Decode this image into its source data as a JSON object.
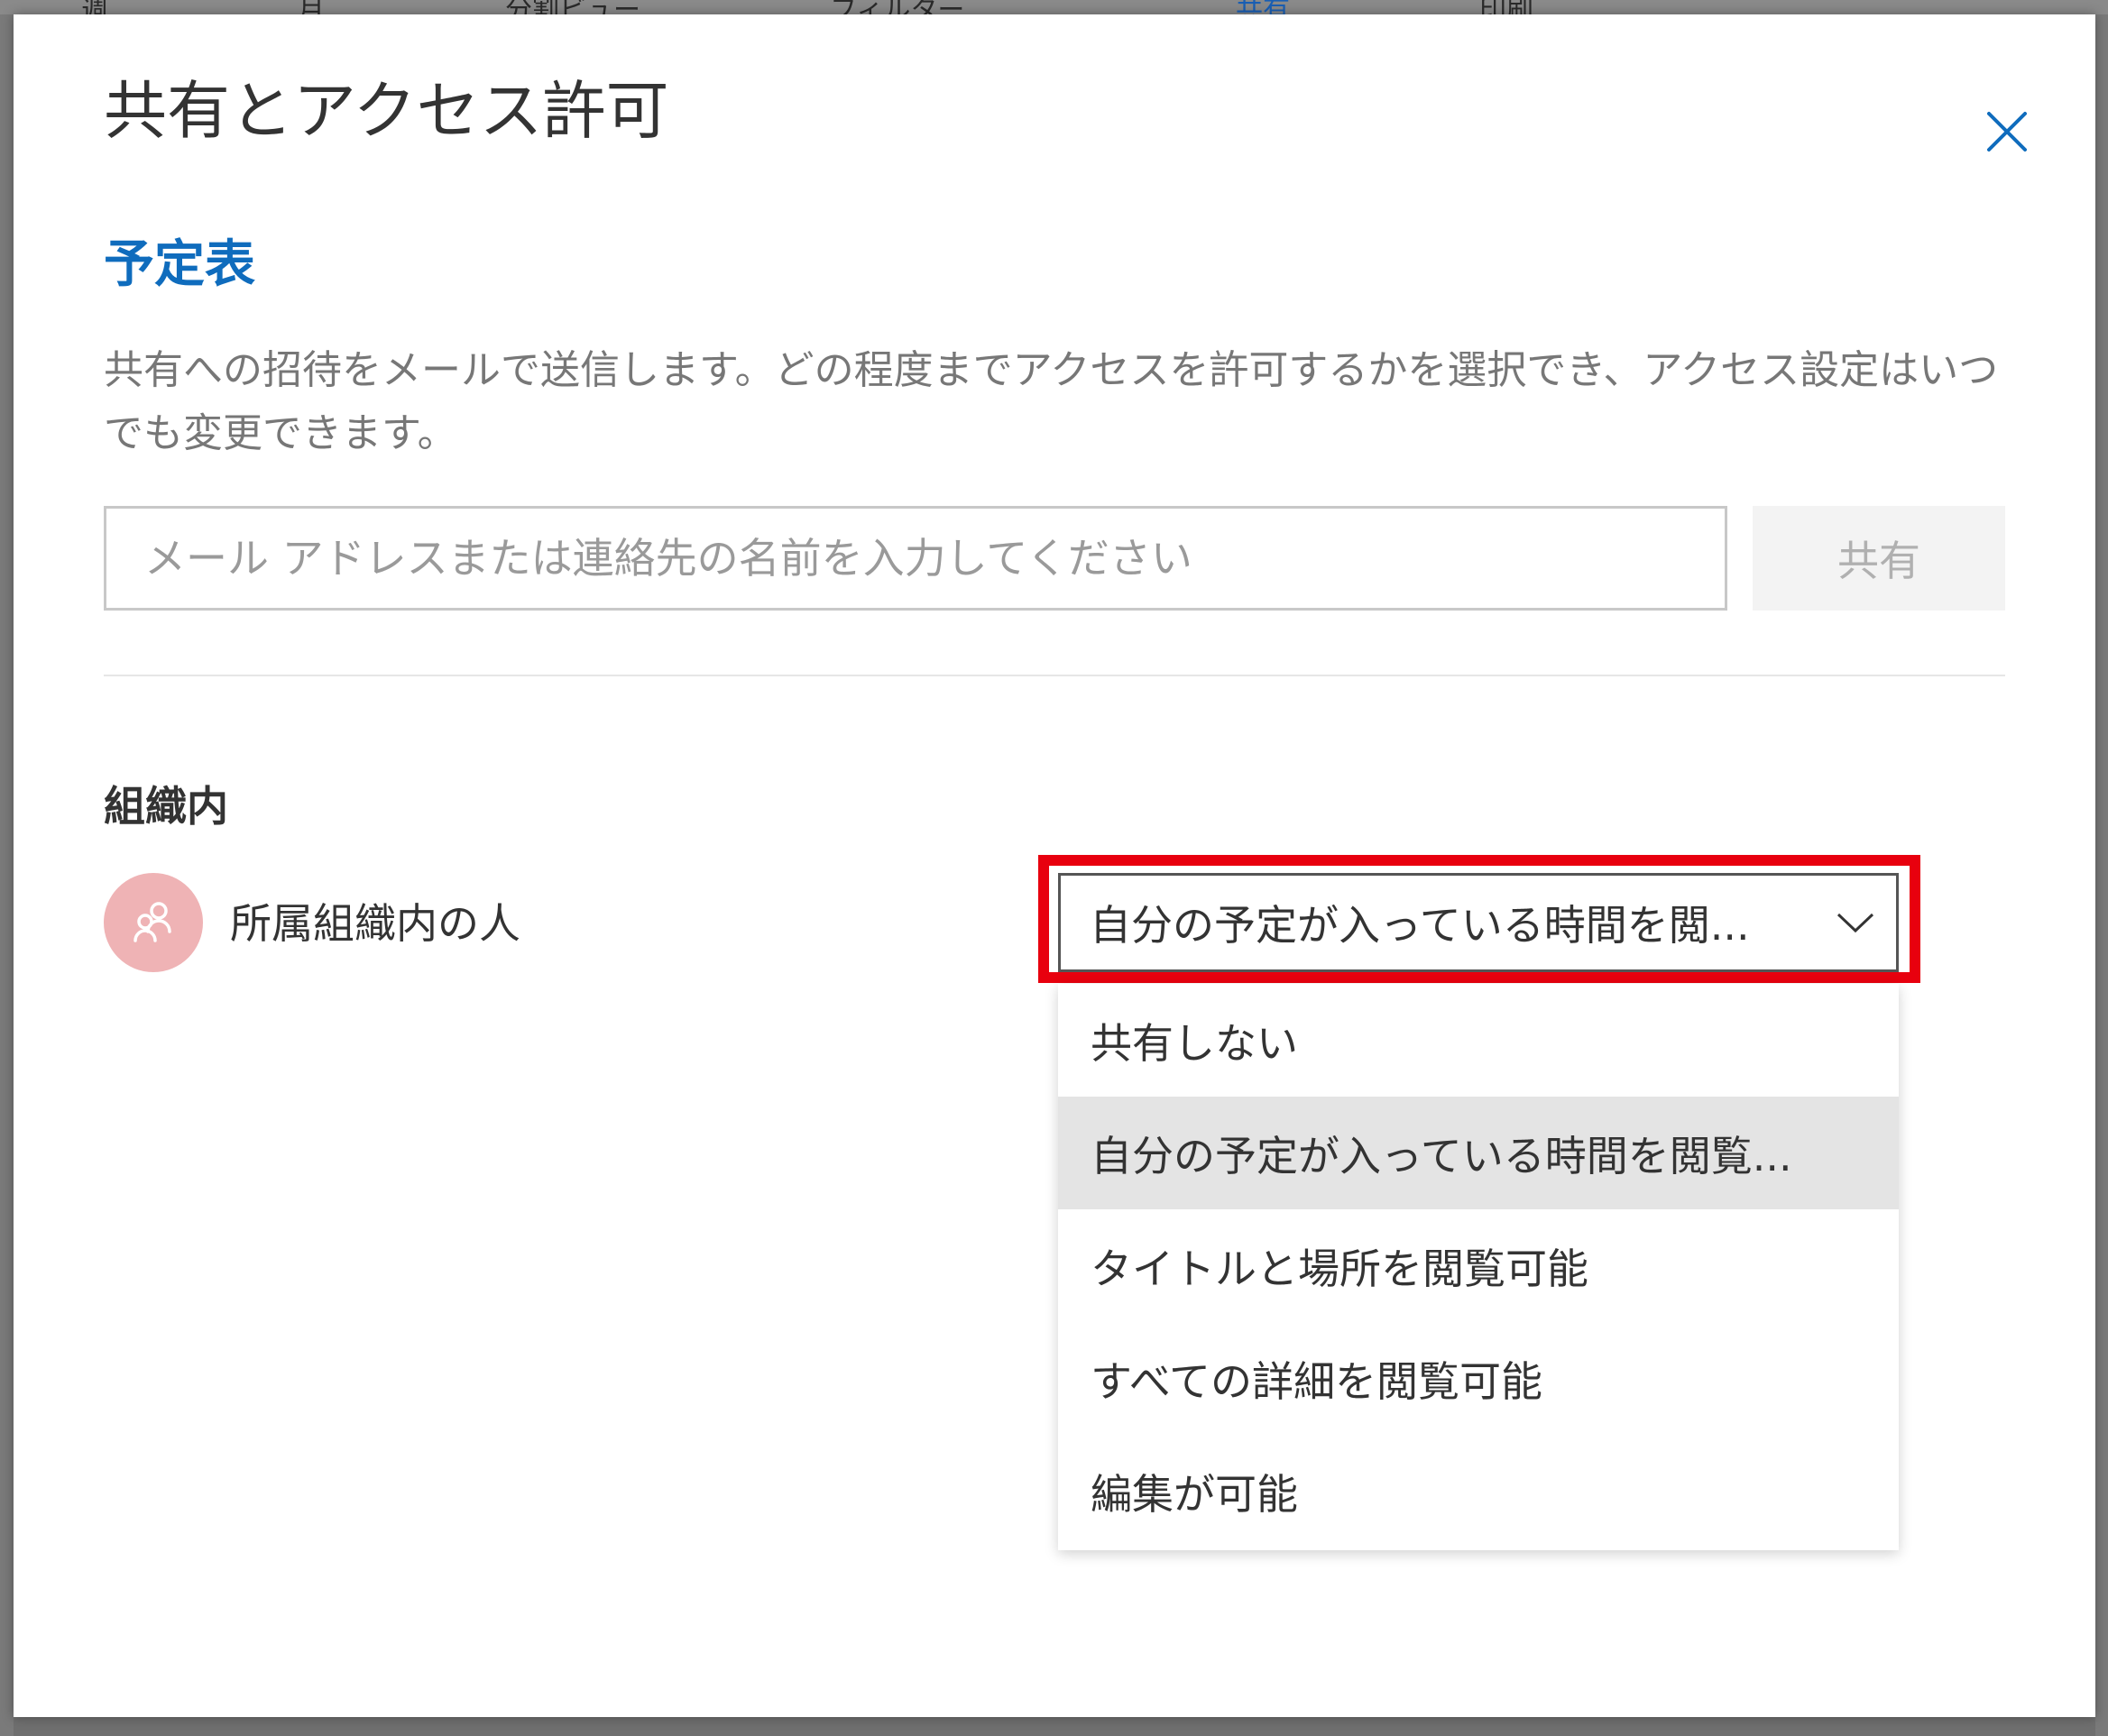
{
  "dialog": {
    "title": "共有とアクセス許可",
    "section_title": "予定表",
    "description": "共有への招待をメールで送信します。どの程度までアクセスを許可するかを選択でき、アクセス設定はいつでも変更できます。",
    "email_placeholder": "メール アドレスまたは連絡先の名前を入力してください",
    "share_button_label": "共有",
    "org_section_heading": "組織内",
    "people_label": "所属組織内の人",
    "permission_select_value": "自分の予定が入っている時間を閲...",
    "dropdown_options": [
      {
        "label": "共有しない",
        "selected": false
      },
      {
        "label": "自分の予定が入っている時間を閲覧...",
        "selected": true
      },
      {
        "label": "タイトルと場所を閲覧可能",
        "selected": false
      },
      {
        "label": "すべての詳細を閲覧可能",
        "selected": false
      },
      {
        "label": "編集が可能",
        "selected": false
      }
    ]
  },
  "background_toolbar": {
    "items": [
      "週",
      "月",
      "分割ビュー",
      "フィルター",
      "共有",
      "印刷"
    ]
  },
  "icons": {
    "close": "close-icon",
    "chevron": "chevron-down-icon",
    "avatar": "people-icon"
  },
  "colors": {
    "accent": "#0f6cbd",
    "highlight": "#e8000e",
    "avatar_bg": "#efb3b5",
    "selected_option_bg": "#e4e4e4"
  }
}
